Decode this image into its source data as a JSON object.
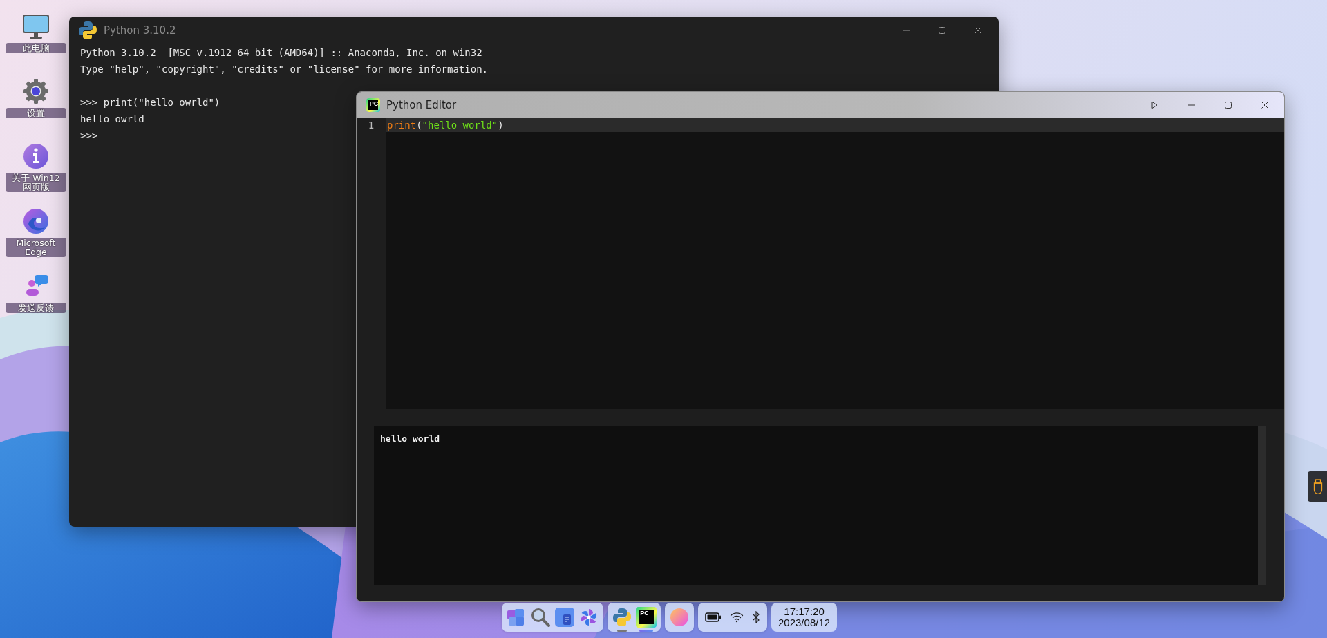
{
  "desktop_icons": [
    {
      "kind": "computer",
      "label": "此电脑"
    },
    {
      "kind": "settings",
      "label": "设置"
    },
    {
      "kind": "info",
      "label": "关于 Win12 网页版"
    },
    {
      "kind": "edge",
      "label": "Microsoft Edge"
    },
    {
      "kind": "feedback",
      "label": "发送反馈"
    }
  ],
  "console_window": {
    "title": "Python 3.10.2",
    "controls": [
      {
        "kind": "minimize"
      },
      {
        "kind": "maximize"
      },
      {
        "kind": "close"
      }
    ],
    "banner": [
      "Python 3.10.2  [MSC v.1912 64 bit (AMD64)] :: Anaconda, Inc. on win32",
      "Type \"help\", \"copyright\", \"credits\" or \"license\" for more information."
    ],
    "session": [
      ">>> print(\"hello owrld\")",
      "hello owrld",
      ">>>"
    ]
  },
  "editor_window": {
    "title": "Python Editor",
    "icon_text": "PC",
    "controls": [
      {
        "kind": "run"
      },
      {
        "kind": "minimize"
      },
      {
        "kind": "maximize"
      },
      {
        "kind": "close"
      }
    ],
    "code_lines": [
      {
        "number": "1",
        "tokens": [
          {
            "kind": "builtin",
            "text": "print"
          },
          {
            "kind": "punct",
            "text": "("
          },
          {
            "kind": "string",
            "text": "\"hello world\""
          },
          {
            "kind": "punct",
            "text": ")"
          }
        ]
      }
    ],
    "output": "hello world"
  },
  "taskbar": {
    "groups": [
      {
        "items": [
          {
            "kind": "start"
          },
          {
            "kind": "search"
          },
          {
            "kind": "document"
          },
          {
            "kind": "pinwheel"
          }
        ]
      },
      {
        "items": [
          {
            "kind": "python",
            "running": true,
            "focused": false
          },
          {
            "kind": "pycharm",
            "icon_text": "PC",
            "running": true,
            "focused": true
          }
        ]
      },
      {
        "items": [
          {
            "kind": "orb"
          }
        ]
      },
      {
        "items": [
          {
            "kind": "battery"
          },
          {
            "kind": "wifi"
          },
          {
            "kind": "bluetooth"
          }
        ]
      }
    ],
    "clock": {
      "time": "17:17:20",
      "date": "2023/08/12"
    }
  },
  "side_widget": {
    "kind": "usb"
  }
}
